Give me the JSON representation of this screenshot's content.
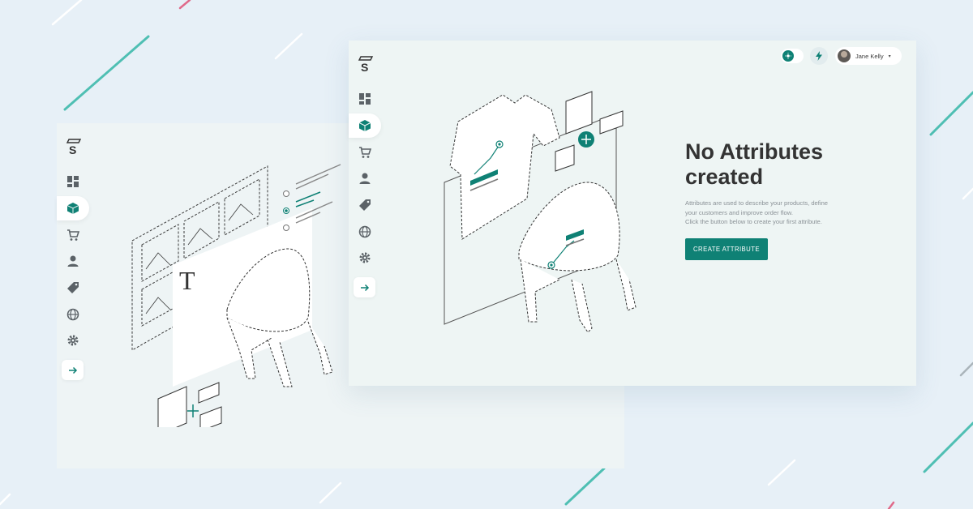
{
  "header": {
    "user_name": "Jane Kelly",
    "user_caret": "▾"
  },
  "sidebar": {
    "logo_letter": "S",
    "items": [
      {
        "name": "home",
        "icon": "dashboard-icon"
      },
      {
        "name": "catalog",
        "icon": "cube-icon",
        "active": true
      },
      {
        "name": "orders",
        "icon": "cart-icon"
      },
      {
        "name": "customers",
        "icon": "user-icon"
      },
      {
        "name": "discounts",
        "icon": "tag-icon"
      },
      {
        "name": "translations",
        "icon": "globe-icon"
      },
      {
        "name": "configuration",
        "icon": "gear-icon"
      }
    ],
    "expand_icon": "arrow-right-icon"
  },
  "empty_state": {
    "title_line1": "No Attributes",
    "title_line2": "created",
    "desc_line1": "Attributes are used to describe your products, define",
    "desc_line2": "your customers and improve order flow.",
    "desc_line3": "Click the button below to create your first attribute.",
    "button_label": "CREATE ATTRIBUTE"
  },
  "illustration_text": {
    "text_tool_letter": "T"
  },
  "colors": {
    "accent": "#0f8175",
    "background": "#e7f0f7",
    "panel": "#eef5f4",
    "icon_gray": "#5b6267"
  }
}
